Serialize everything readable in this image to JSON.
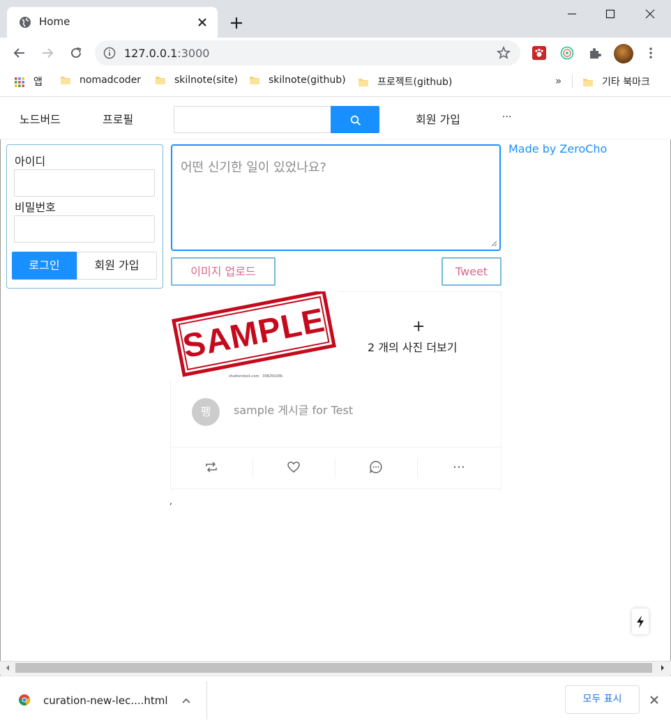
{
  "browser": {
    "tab_title": "Home",
    "url_host": "127.0.0.1",
    "url_port": ":3000",
    "bookmarks": [
      {
        "label": "앱",
        "icon": "apps-grid-icon"
      },
      {
        "label": "nomadcoder",
        "icon": "folder-icon"
      },
      {
        "label": "skilnote(site)",
        "icon": "folder-icon"
      },
      {
        "label": "skilnote(github)",
        "icon": "folder-icon"
      },
      {
        "label": "프로젝트(github)",
        "icon": "folder-icon"
      }
    ],
    "bookmarks_more": "»",
    "other_bookmarks": "기타 북마크"
  },
  "nav": {
    "noticeboard": "노드버드",
    "profile": "프로필",
    "signup": "회원 가입",
    "more": "···"
  },
  "login": {
    "id_label": "아이디",
    "password_label": "비밀번호",
    "login_button": "로그인",
    "signup_button": "회원 가입"
  },
  "post_form": {
    "placeholder": "어떤 신기한 일이 있었나요?",
    "upload_button": "이미지 업로드",
    "tweet_button": "Tweet"
  },
  "credit": "Made by ZeroCho",
  "post": {
    "image_label": "SAMPLE",
    "image_credit": "shutterstock.com · 308250266",
    "more_plus": "+",
    "more_images": "2 개의 사진 더보기",
    "author_initial": "펭",
    "content": "sample 게시글 for Test",
    "actions": [
      "retweet-icon",
      "heart-icon",
      "message-icon",
      "ellipsis-icon"
    ]
  },
  "stray_text": ",",
  "downloads": {
    "filename": "curation-new-lec....html",
    "show_all": "모두 표시"
  },
  "colors": {
    "primary": "#1890ff",
    "card_border": "#7ab8d8",
    "pink_text": "#d66a8a",
    "stamp_red": "#c40a1c"
  }
}
